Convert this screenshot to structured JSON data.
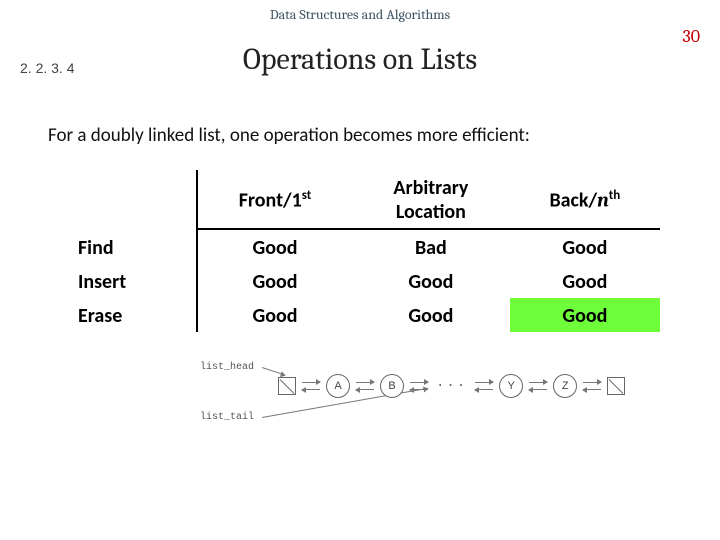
{
  "course_title": "Data Structures and Algorithms",
  "page_number": "30",
  "section_number": "2. 2. 3. 4",
  "slide_title": "Operations on Lists",
  "lead_text": "For a doubly linked list, one operation becomes more efficient:",
  "table": {
    "col_headers": {
      "front_prefix": "Front/1",
      "front_sup": "st",
      "arbitrary_line1": "Arbitrary",
      "arbitrary_line2": "Location",
      "back_prefix": "Back/",
      "back_var": "n",
      "back_sup": "th"
    },
    "rows": [
      {
        "label": "Find",
        "front": "Good",
        "arbitrary": "Bad",
        "back": "Good",
        "back_hl": false
      },
      {
        "label": "Insert",
        "front": "Good",
        "arbitrary": "Good",
        "back": "Good",
        "back_hl": false
      },
      {
        "label": "Erase",
        "front": "Good",
        "arbitrary": "Good",
        "back": "Good",
        "back_hl": true
      }
    ]
  },
  "diagram": {
    "head_label": "list_head",
    "tail_label": "list_tail",
    "nodes": [
      "A",
      "B",
      "Y",
      "Z"
    ]
  }
}
